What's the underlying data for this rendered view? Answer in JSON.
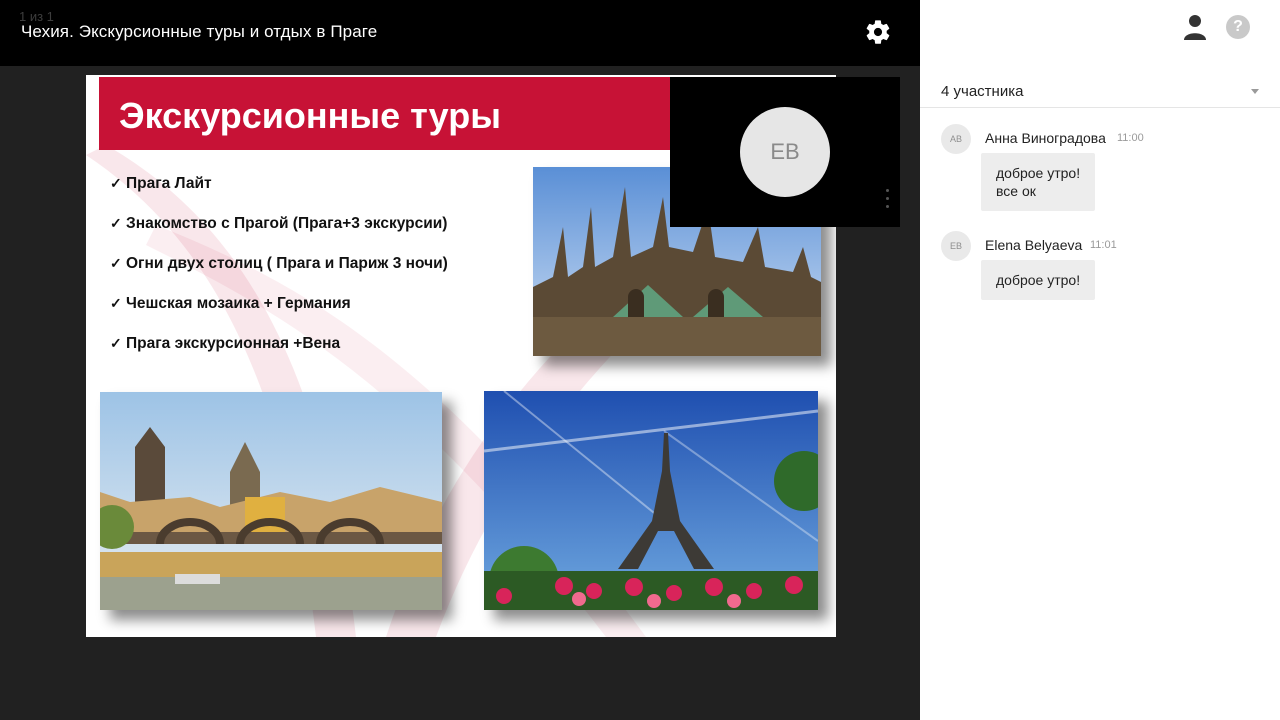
{
  "stage": {
    "page_counter": "1 из 1",
    "title": "Чехия. Экскурсионные туры и отдых в Праге"
  },
  "slide": {
    "title": "Экскурсионные туры",
    "bullets": [
      "Прага Лайт",
      "Знакомство с Прагой (Прага+3 экскурсии)",
      "Огни двух столиц ( Прага и Париж 3 ночи)",
      "Чешская мозаика + Германия",
      "Прага экскурсионная +Вена"
    ],
    "check_glyph": "✓",
    "header_color": "#c71236"
  },
  "video": {
    "initials": "EB"
  },
  "sidebar": {
    "participants_label": "4 участника",
    "help_glyph": "?",
    "messages": [
      {
        "initials": "AB",
        "author": "Анна Виноградова",
        "time": "11:00",
        "lines": [
          "доброе утро!",
          "все ок"
        ]
      },
      {
        "initials": "EB",
        "author": "Elena Belyaeva",
        "time": "11:01",
        "lines": [
          "доброе утро!"
        ]
      }
    ]
  },
  "icons": [
    "gear-icon",
    "user-icon",
    "help-icon",
    "chevron-down-icon",
    "more-vertical-icon"
  ]
}
